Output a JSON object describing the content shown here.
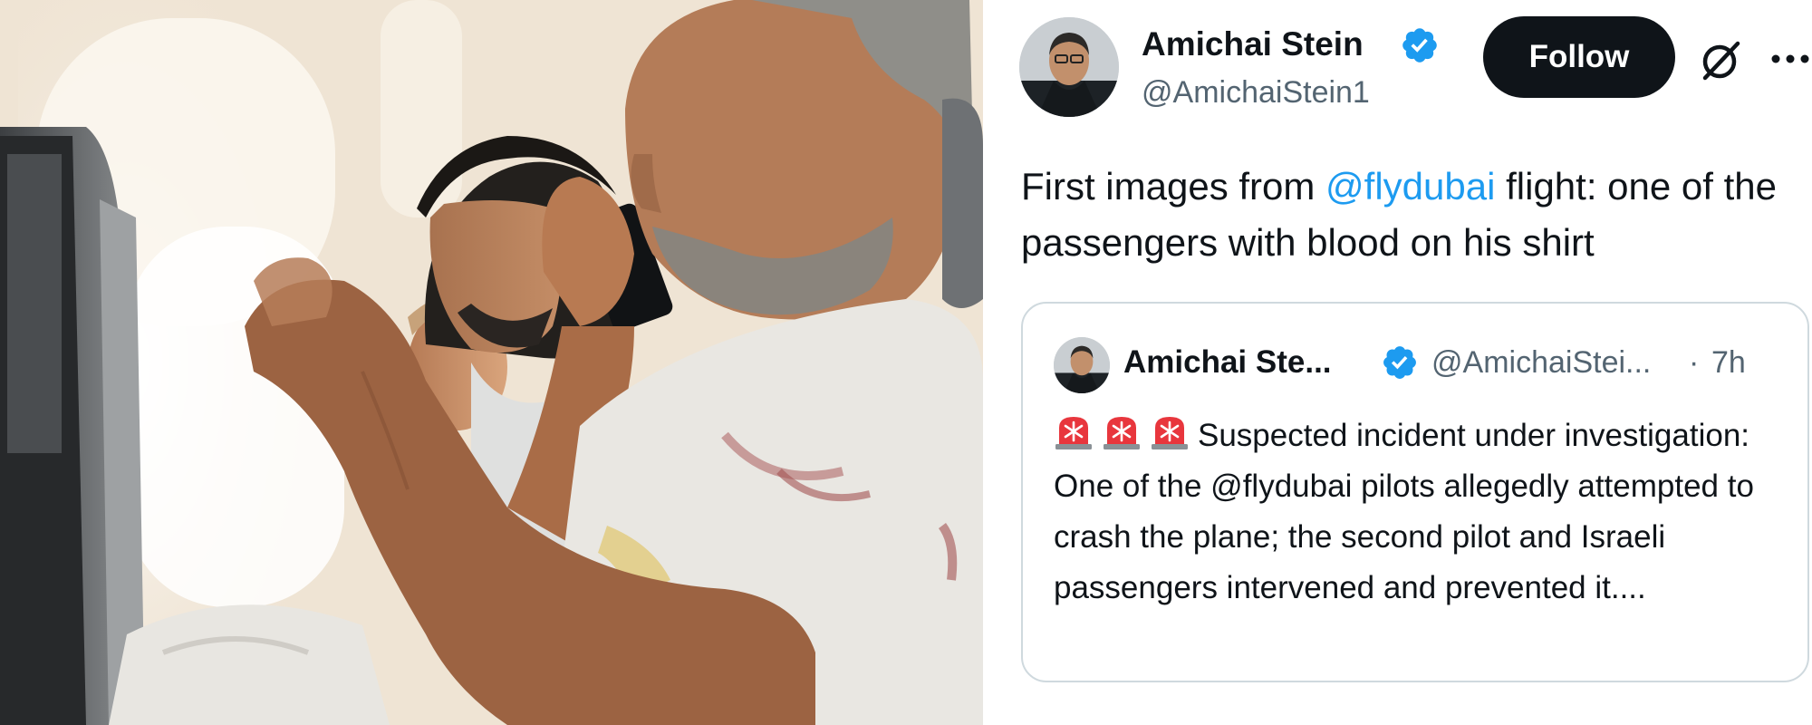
{
  "tweet": {
    "author_name": "Amichai Stein",
    "handle": "@AmichaiStein1",
    "follow_label": "Follow",
    "more_label": "···",
    "text": {
      "before": "First images from ",
      "mention": "@flydubai",
      "after": " flight: one of the passengers with blood on his shirt"
    },
    "quote": {
      "author_name": "Amichai Ste...",
      "handle": "@AmichaiStei...",
      "separator": "·",
      "time": "7h",
      "icons": [
        "rotating-light-emoji",
        "rotating-light-emoji",
        "rotating-light-emoji"
      ],
      "body": "Suspected incident under investigation: One of the @flydubai pilots allegedly attempted to crash the plane; the second pilot and Israeli passengers intervened and prevented it...."
    }
  },
  "colors": {
    "text": "#0f1419",
    "secondary": "#536471",
    "link": "#1d9bf0",
    "button_bg": "#0f1419",
    "border": "#cfd9de",
    "verified": "#1d9bf0",
    "siren": "#e8363d"
  }
}
